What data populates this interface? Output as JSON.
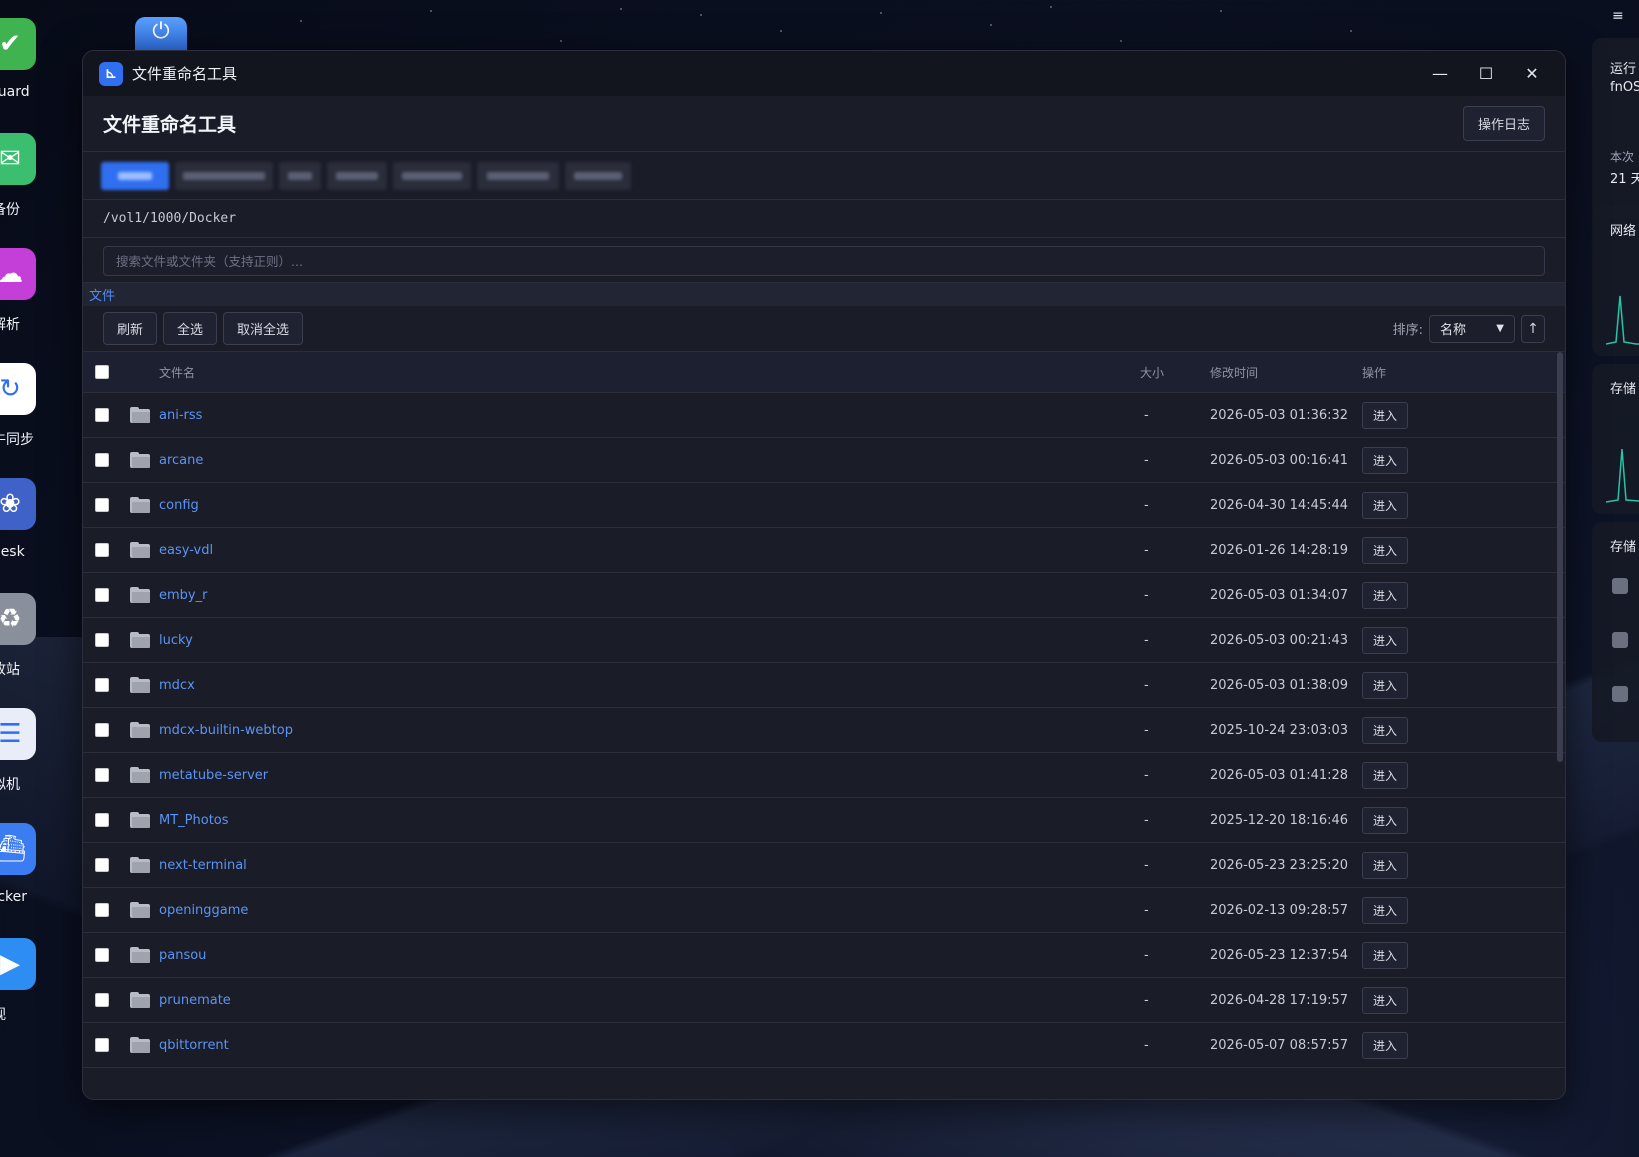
{
  "desktop": {
    "icons": [
      {
        "label": "dGuard",
        "icon": "shield-check-icon",
        "color": "#3fb34f"
      },
      {
        "label": "微备份",
        "icon": "chat-backup-icon",
        "color": "#3bbf6e"
      },
      {
        "label": "轻解析",
        "icon": "cloud-download-icon",
        "color": "#c43fd8"
      },
      {
        "label": "飞牛同步",
        "icon": "sync-icon",
        "color": "#ffffff"
      },
      {
        "label": "fndesk",
        "icon": "paw-icon",
        "color": "#3e62c7"
      },
      {
        "label": "回收站",
        "icon": "trash-icon",
        "color": "#8a8f9c"
      },
      {
        "label": "虚拟机",
        "icon": "server-icon",
        "color": "#e8edf7"
      },
      {
        "label": "Docker",
        "icon": "docker-icon",
        "color": "#3c7cf2"
      },
      {
        "label": "影视",
        "icon": "play-icon",
        "color": "#2e8df2"
      }
    ]
  },
  "right_panel": {
    "items": [
      "运行",
      "fnOS",
      "本次",
      "21 天",
      "网络",
      "存储",
      "存储"
    ]
  },
  "window": {
    "title": "文件重命名工具",
    "controls": {
      "minimize": "—",
      "maximize": "☐",
      "close": "✕"
    }
  },
  "header": {
    "title": "文件重命名工具",
    "log_button": "操作日志"
  },
  "path": "/vol1/1000/Docker",
  "search": {
    "placeholder": "搜索文件或文件夹（支持正则）..."
  },
  "crumb": "文件",
  "toolbar": {
    "refresh": "刷新",
    "select_all": "全选",
    "deselect_all": "取消全选",
    "sort_label": "排序:",
    "sort_value": "名称",
    "sort_direction": "↑"
  },
  "table": {
    "headers": {
      "name": "文件名",
      "size": "大小",
      "modified": "修改时间",
      "action": "操作"
    },
    "rows": [
      {
        "name": "ani-rss",
        "size": "-",
        "modified": "2026-05-03 01:36:32",
        "action": "进入"
      },
      {
        "name": "arcane",
        "size": "-",
        "modified": "2026-05-03 00:16:41",
        "action": "进入"
      },
      {
        "name": "config",
        "size": "-",
        "modified": "2026-04-30 14:45:44",
        "action": "进入"
      },
      {
        "name": "easy-vdl",
        "size": "-",
        "modified": "2026-01-26 14:28:19",
        "action": "进入"
      },
      {
        "name": "emby_r",
        "size": "-",
        "modified": "2026-05-03 01:34:07",
        "action": "进入"
      },
      {
        "name": "lucky",
        "size": "-",
        "modified": "2026-05-03 00:21:43",
        "action": "进入"
      },
      {
        "name": "mdcx",
        "size": "-",
        "modified": "2026-05-03 01:38:09",
        "action": "进入"
      },
      {
        "name": "mdcx-builtin-webtop",
        "size": "-",
        "modified": "2025-10-24 23:03:03",
        "action": "进入"
      },
      {
        "name": "metatube-server",
        "size": "-",
        "modified": "2026-05-03 01:41:28",
        "action": "进入"
      },
      {
        "name": "MT_Photos",
        "size": "-",
        "modified": "2025-12-20 18:16:46",
        "action": "进入"
      },
      {
        "name": "next-terminal",
        "size": "-",
        "modified": "2026-05-23 23:25:20",
        "action": "进入"
      },
      {
        "name": "openinggame",
        "size": "-",
        "modified": "2026-02-13 09:28:57",
        "action": "进入"
      },
      {
        "name": "pansou",
        "size": "-",
        "modified": "2026-05-23 12:37:54",
        "action": "进入"
      },
      {
        "name": "prunemate",
        "size": "-",
        "modified": "2026-04-28 17:19:57",
        "action": "进入"
      },
      {
        "name": "qbittorrent",
        "size": "-",
        "modified": "2026-05-07 08:57:57",
        "action": "进入"
      }
    ]
  }
}
